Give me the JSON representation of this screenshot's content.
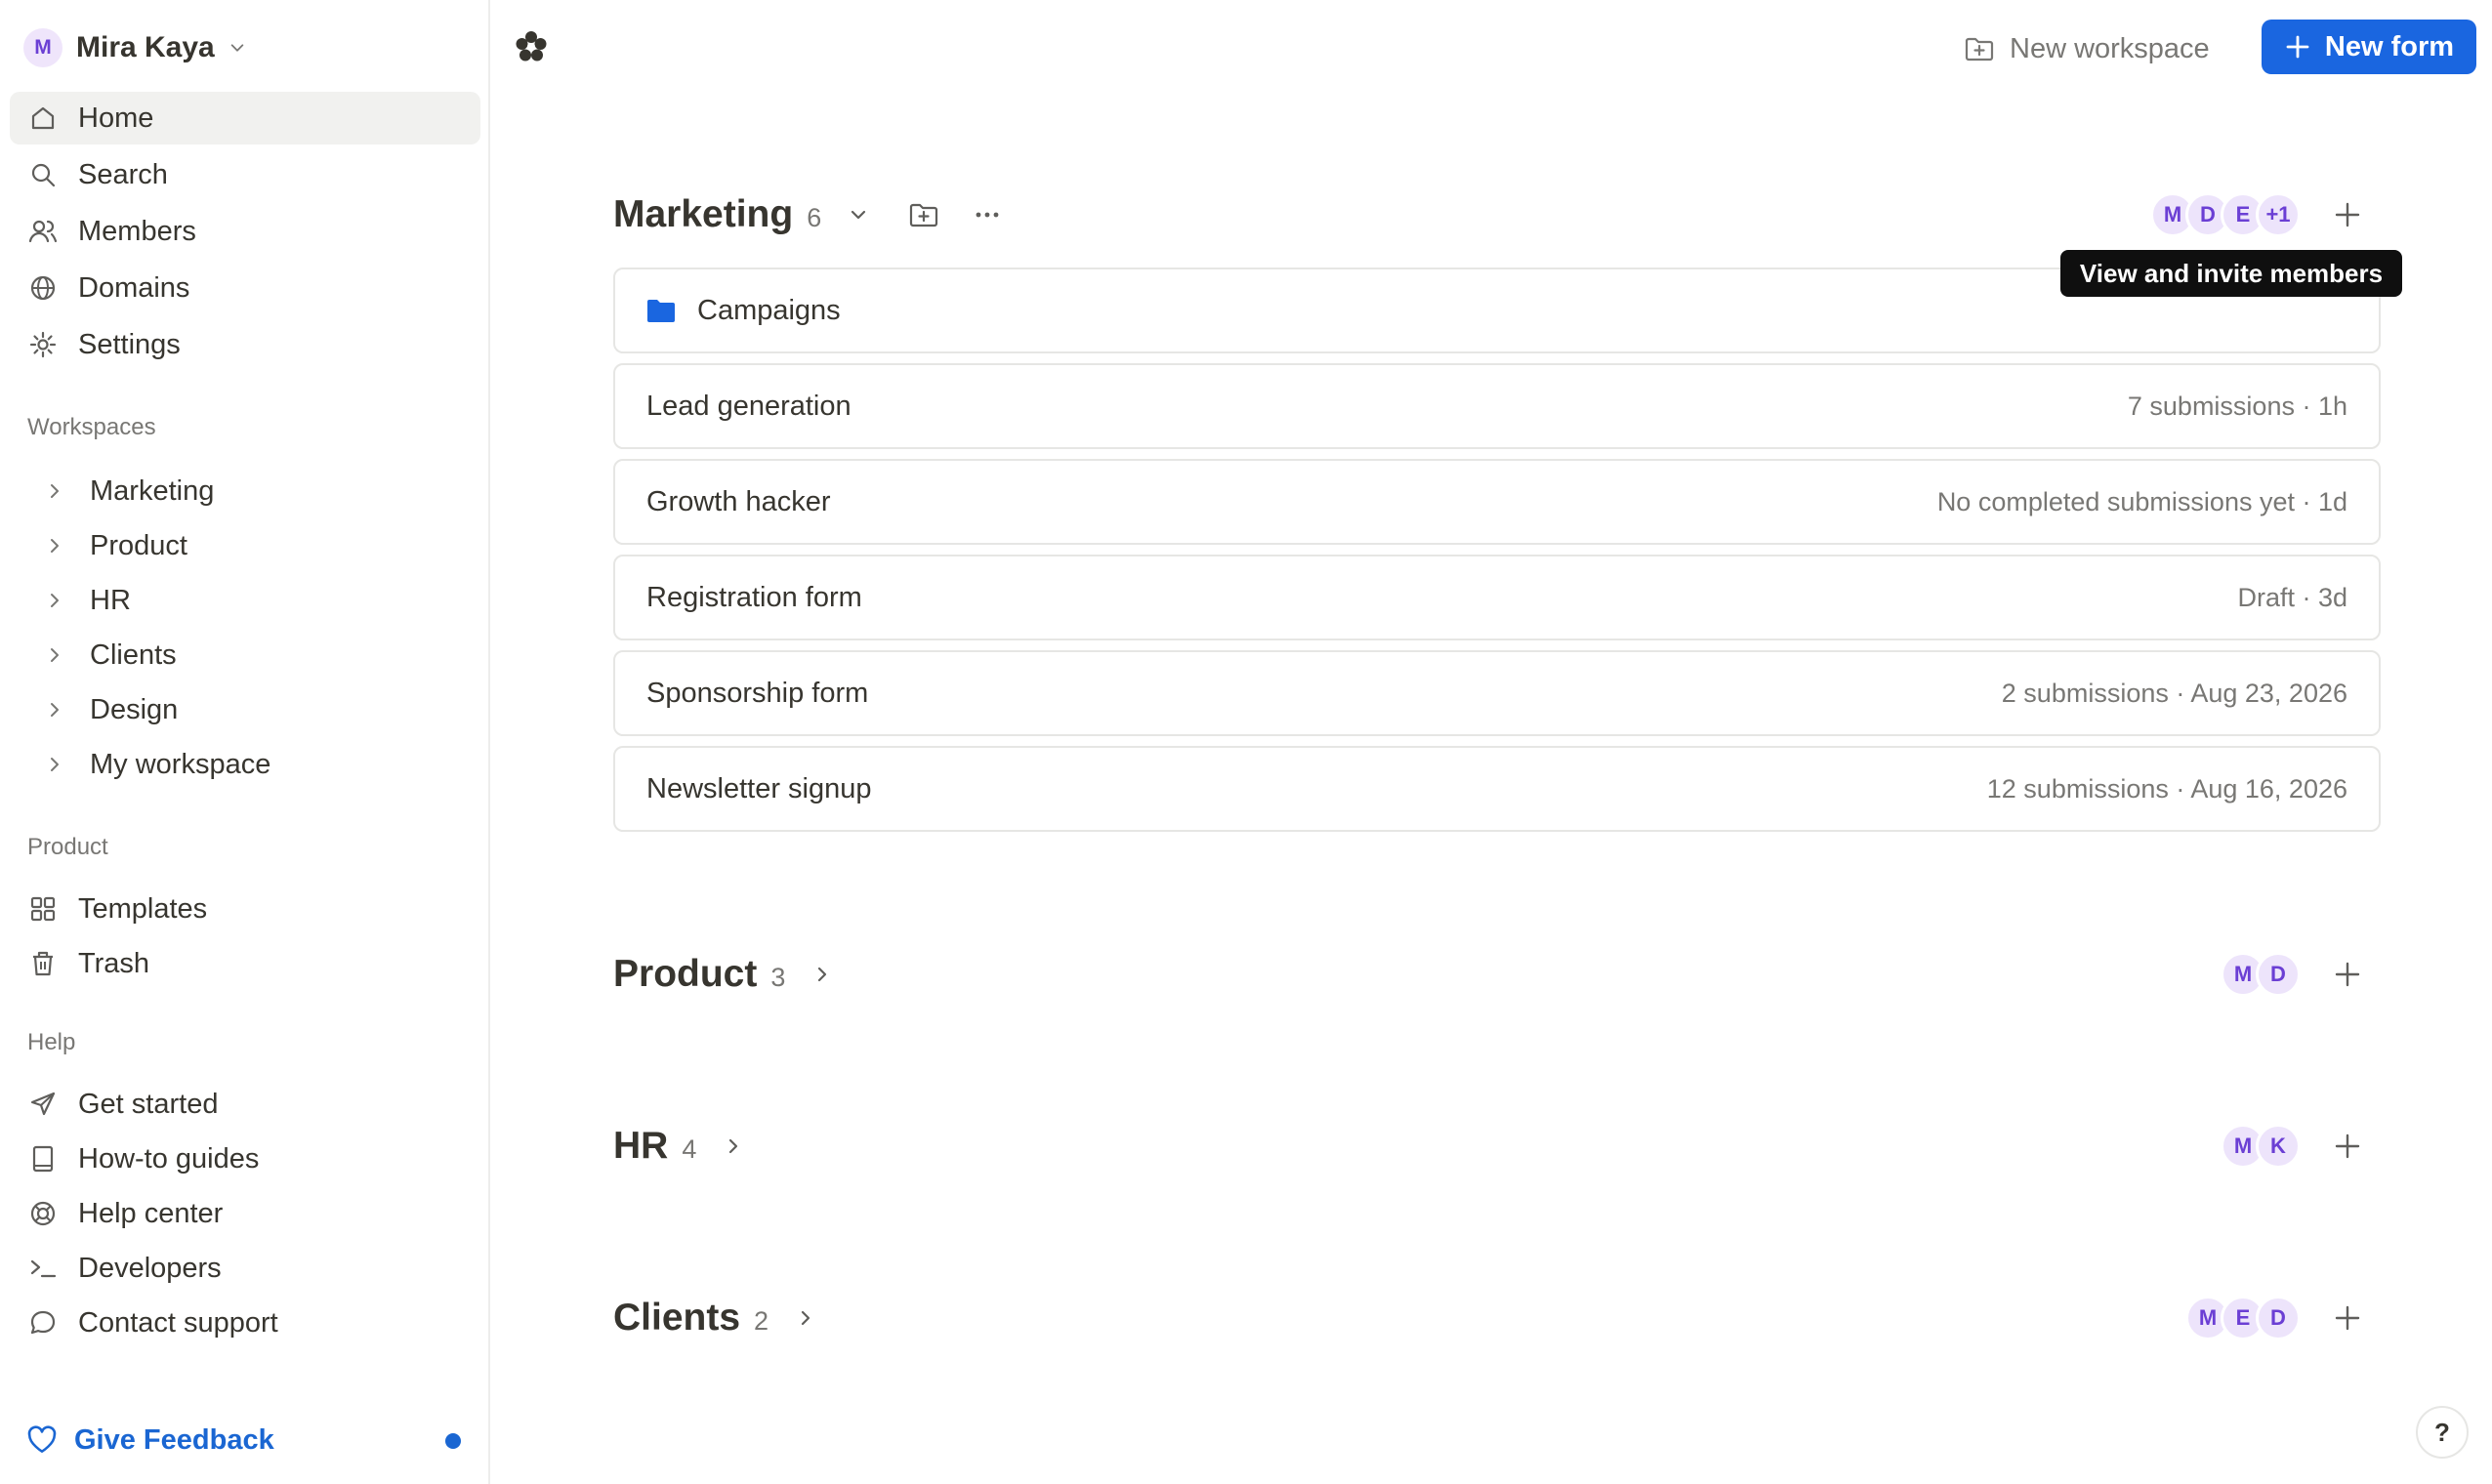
{
  "user": {
    "initial": "M",
    "name": "Mira Kaya"
  },
  "nav": {
    "home": "Home",
    "search": "Search",
    "members": "Members",
    "domains": "Domains",
    "settings": "Settings"
  },
  "workspaces": {
    "label": "Workspaces",
    "items": [
      "Marketing",
      "Product",
      "HR",
      "Clients",
      "Design",
      "My workspace"
    ]
  },
  "product": {
    "label": "Product",
    "templates": "Templates",
    "trash": "Trash"
  },
  "help": {
    "label": "Help",
    "get_started": "Get started",
    "guides": "How-to guides",
    "help_center": "Help center",
    "developers": "Developers",
    "contact": "Contact support"
  },
  "feedback": "Give Feedback",
  "header": {
    "new_workspace": "New workspace",
    "new_form": "New form"
  },
  "tooltip": "View and invite members",
  "marketing": {
    "title": "Marketing",
    "count": "6",
    "members": [
      "M",
      "D",
      "E",
      "+1"
    ],
    "folder": "Campaigns",
    "forms": [
      {
        "name": "Lead generation",
        "meta": "7 submissions · 1h"
      },
      {
        "name": "Growth hacker",
        "meta": "No completed submissions yet · 1d"
      },
      {
        "name": "Registration form",
        "meta": "Draft · 3d"
      },
      {
        "name": "Sponsorship form",
        "meta": "2 submissions · Aug 23, 2026"
      },
      {
        "name": "Newsletter signup",
        "meta": "12 submissions · Aug 16, 2026"
      }
    ]
  },
  "groups": [
    {
      "title": "Product",
      "count": "3",
      "members": [
        "M",
        "D"
      ]
    },
    {
      "title": "HR",
      "count": "4",
      "members": [
        "M",
        "K"
      ]
    },
    {
      "title": "Clients",
      "count": "2",
      "members": [
        "M",
        "E",
        "D"
      ]
    }
  ],
  "help_button": "?",
  "colors": {
    "accent": "#1a66e0",
    "avatar_bg": "#ede4fb",
    "avatar_text": "#6b3fd4"
  }
}
